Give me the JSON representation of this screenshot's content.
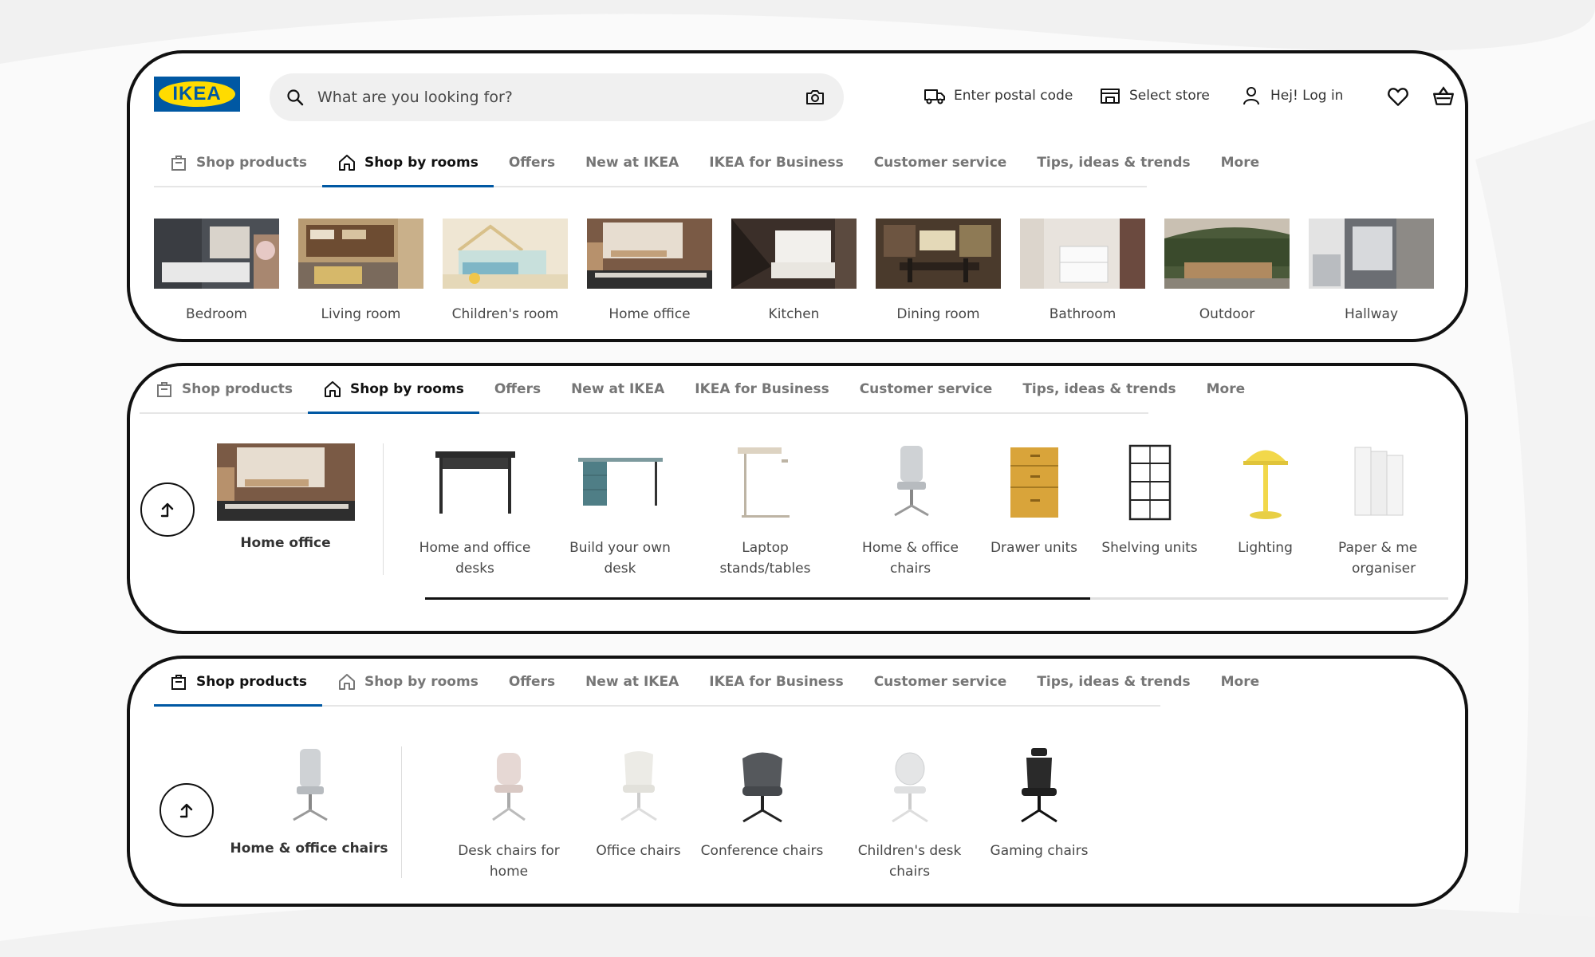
{
  "brand": {
    "logo_text": "IKEA",
    "blue": "#0058a3",
    "yellow": "#ffdb00"
  },
  "header": {
    "search_placeholder": "What are you looking for?",
    "postal": "Enter postal code",
    "store": "Select store",
    "login": "Hej! Log in",
    "icons": [
      "search-icon",
      "camera-icon",
      "delivery-truck-icon",
      "store-icon",
      "user-icon",
      "heart-icon",
      "shopping-bag-icon"
    ]
  },
  "tabs": [
    {
      "label": "Shop products",
      "icon": "shopping-bag-icon"
    },
    {
      "label": "Shop by rooms",
      "icon": "house-icon"
    },
    {
      "label": "Offers"
    },
    {
      "label": "New at IKEA"
    },
    {
      "label": "IKEA for Business"
    },
    {
      "label": "Customer service"
    },
    {
      "label": "Tips, ideas & trends"
    },
    {
      "label": "More"
    }
  ],
  "panel1": {
    "active_tab": "Shop by rooms",
    "rooms": [
      {
        "label": "Bedroom"
      },
      {
        "label": "Living room"
      },
      {
        "label": "Children's room"
      },
      {
        "label": "Home office"
      },
      {
        "label": "Kitchen"
      },
      {
        "label": "Dining room"
      },
      {
        "label": "Bathroom"
      },
      {
        "label": "Outdoor"
      },
      {
        "label": "Hallway"
      }
    ]
  },
  "panel2": {
    "active_tab": "Shop by rooms",
    "featured": "Home office",
    "categories": [
      {
        "l1": "Home and office",
        "l2": "desks"
      },
      {
        "l1": "Build your own",
        "l2": "desk"
      },
      {
        "l1": "Laptop",
        "l2": "stands/tables"
      },
      {
        "l1": "Home & office",
        "l2": "chairs"
      },
      {
        "l1": "Drawer units",
        "l2": ""
      },
      {
        "l1": "Shelving units",
        "l2": ""
      },
      {
        "l1": "Lighting",
        "l2": ""
      },
      {
        "l1": "Paper & me",
        "l2": "organiser"
      }
    ],
    "scroll_fraction": 0.65
  },
  "panel3": {
    "active_tab": "Shop products",
    "featured": "Home & office chairs",
    "categories": [
      {
        "l1": "Desk chairs for",
        "l2": "home"
      },
      {
        "l1": "Office chairs",
        "l2": ""
      },
      {
        "l1": "Conference chairs",
        "l2": ""
      },
      {
        "l1": "Children's desk",
        "l2": "chairs"
      },
      {
        "l1": "Gaming chairs",
        "l2": ""
      }
    ]
  }
}
